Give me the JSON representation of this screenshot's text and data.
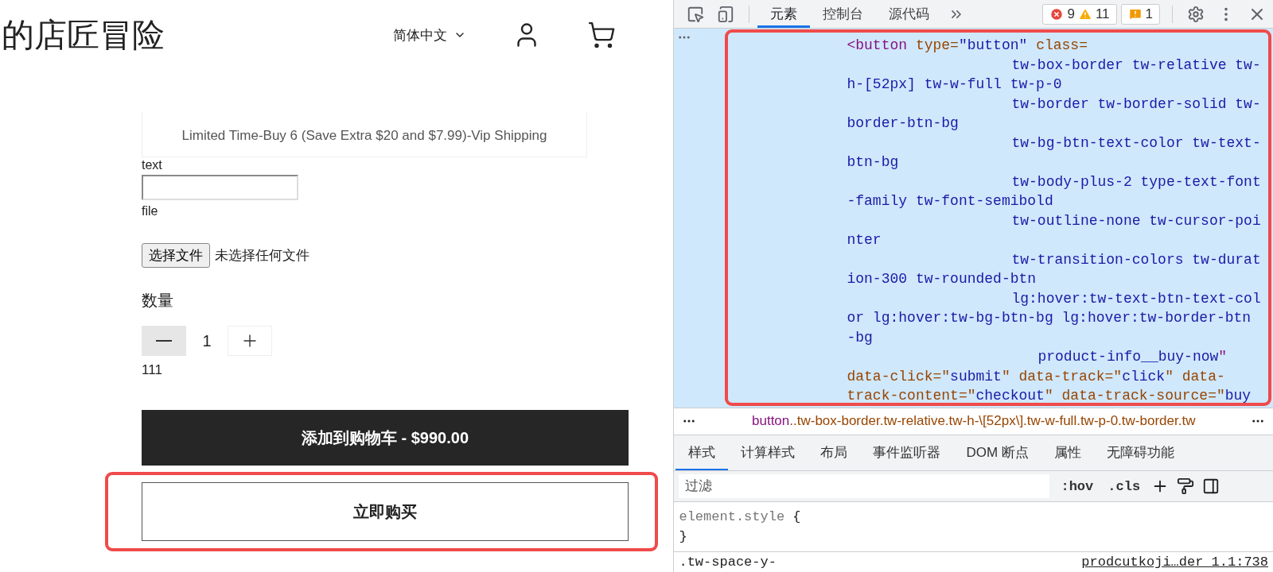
{
  "store": {
    "title": "的店匠冒险",
    "language": "简体中文"
  },
  "product": {
    "promo": "Limited Time-Buy 6 (Save Extra $20 and $7.99)-Vip Shipping",
    "text_label": "text",
    "file_label": "file",
    "file_button": "选择文件",
    "file_status": "未选择任何文件",
    "quantity_label": "数量",
    "quantity": "1",
    "decrease_disabled": true,
    "note": "111",
    "add_to_cart": "添加到购物车 - $990.00",
    "buy_now": "立即购买",
    "buy_now_highlighted": true
  },
  "devtools": {
    "tabs": [
      {
        "label": "元素",
        "selected": true
      },
      {
        "label": "控制台",
        "selected": false
      },
      {
        "label": "源代码",
        "selected": false
      }
    ],
    "errors": "9",
    "warnings": "11",
    "issues": "1",
    "code": {
      "selected": true,
      "highlighted": true,
      "lines": [
        {
          "kind": "start",
          "segments": [
            {
              "kind": "tag",
              "text": "<button"
            },
            {
              "kind": "attr",
              "text": " type="
            },
            {
              "kind": "value",
              "text": "\"button\""
            },
            {
              "kind": "attr",
              "text": " class="
            }
          ]
        },
        {
          "kind": "indent",
          "segments": [
            {
              "kind": "value",
              "text": "tw-box-border tw-relative tw-"
            }
          ]
        },
        {
          "kind": "wrap",
          "segments": [
            {
              "kind": "value",
              "text": "h-[52px] tw-w-full tw-p-0"
            }
          ]
        },
        {
          "kind": "indent",
          "segments": [
            {
              "kind": "value",
              "text": "tw-border tw-border-solid tw-"
            }
          ]
        },
        {
          "kind": "wrap",
          "segments": [
            {
              "kind": "value",
              "text": "border-btn-bg"
            }
          ]
        },
        {
          "kind": "indent",
          "segments": [
            {
              "kind": "value",
              "text": "tw-bg-btn-text-color tw-text-"
            }
          ]
        },
        {
          "kind": "wrap",
          "segments": [
            {
              "kind": "value",
              "text": "btn-bg"
            }
          ]
        },
        {
          "kind": "indent",
          "segments": [
            {
              "kind": "value",
              "text": "tw-body-plus-2 type-text-font"
            }
          ]
        },
        {
          "kind": "wrap",
          "segments": [
            {
              "kind": "value",
              "text": "-family tw-font-semibold"
            }
          ]
        },
        {
          "kind": "indent",
          "segments": [
            {
              "kind": "value",
              "text": "tw-outline-none tw-cursor-poi"
            }
          ]
        },
        {
          "kind": "wrap",
          "segments": [
            {
              "kind": "value",
              "text": "nter"
            }
          ]
        },
        {
          "kind": "indent",
          "segments": [
            {
              "kind": "value",
              "text": "tw-transition-colors tw-durat"
            }
          ]
        },
        {
          "kind": "wrap",
          "segments": [
            {
              "kind": "value",
              "text": "ion-300 tw-rounded-btn"
            }
          ]
        },
        {
          "kind": "indent",
          "segments": [
            {
              "kind": "value",
              "text": "lg:hover:tw-text-btn-text-col"
            }
          ]
        },
        {
          "kind": "wrap",
          "segments": [
            {
              "kind": "value",
              "text": "or lg:hover:tw-bg-btn-bg lg:hover:tw-border-btn"
            }
          ]
        },
        {
          "kind": "wrap",
          "segments": [
            {
              "kind": "value",
              "text": "-bg"
            }
          ]
        },
        {
          "kind": "deep",
          "segments": [
            {
              "kind": "value",
              "text": "product-info__buy-now"
            },
            {
              "kind": "tag",
              "text": "\""
            }
          ]
        },
        {
          "kind": "wrap",
          "segments": [
            {
              "kind": "attr",
              "text": "data-click=\""
            },
            {
              "kind": "value",
              "text": "submit"
            },
            {
              "kind": "attr",
              "text": "\" data-track=\""
            },
            {
              "kind": "value",
              "text": "click"
            },
            {
              "kind": "attr",
              "text": "\" data-"
            }
          ]
        },
        {
          "kind": "wrap",
          "segments": [
            {
              "kind": "attr",
              "text": "track-content=\""
            },
            {
              "kind": "value",
              "text": "checkout"
            },
            {
              "kind": "attr",
              "text": "\" data-track-source=\""
            },
            {
              "kind": "value",
              "text": "buy"
            }
          ]
        }
      ]
    },
    "breadcrumb": {
      "tag": "button",
      "rest": "..tw-box-border.tw-relative.tw-h-\\[52px\\].tw-w-full.tw-p-0.tw-border.tw"
    },
    "style_tabs": [
      {
        "label": "样式",
        "selected": true
      },
      {
        "label": "计算样式",
        "selected": false
      },
      {
        "label": "布局",
        "selected": false
      },
      {
        "label": "事件监听器",
        "selected": false
      },
      {
        "label": "DOM 断点",
        "selected": false
      },
      {
        "label": "属性",
        "selected": false
      },
      {
        "label": "无障碍功能",
        "selected": false
      }
    ],
    "filter": {
      "placeholder": "过滤",
      "hov": ":hov",
      "cls": ".cls"
    },
    "rules": {
      "selector": "element.style",
      "open": "{",
      "close": "}",
      "next_selector": ".tw-space-y-",
      "source": "prodcutkoji…der_1.1:738"
    }
  }
}
